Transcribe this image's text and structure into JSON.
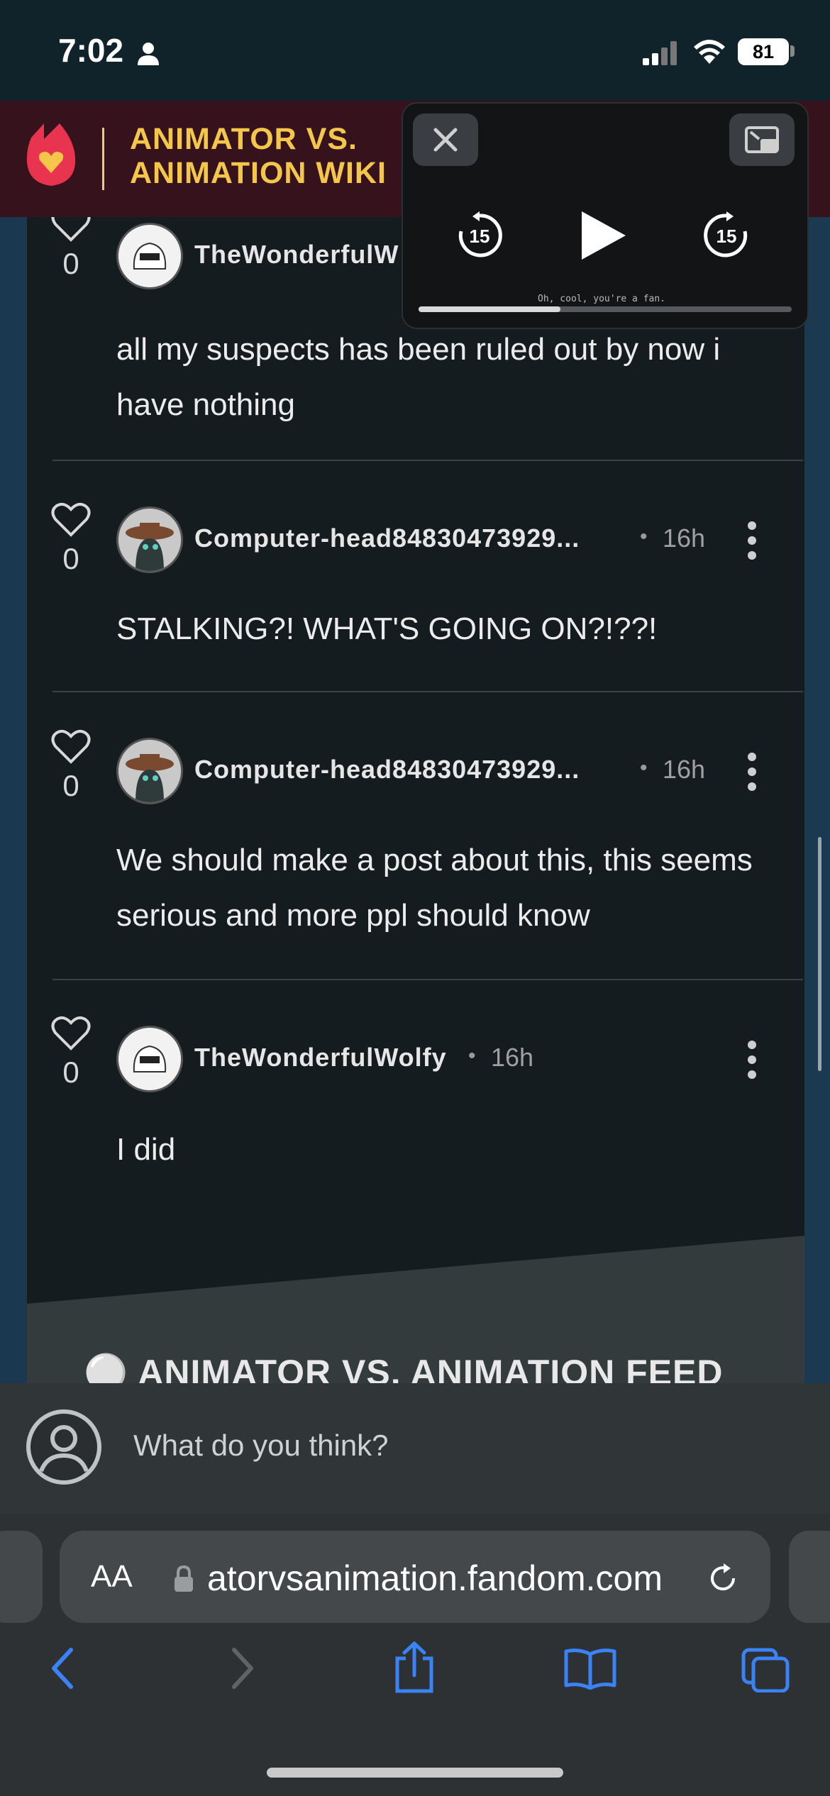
{
  "status_bar": {
    "time": "7:02",
    "battery": "81"
  },
  "wiki_header": {
    "title": "ANIMATOR VS. ANIMATION WIKI"
  },
  "pip_player": {
    "subtitle": "Oh, cool, you're a fan.",
    "skip_back_seconds": "15",
    "skip_forward_seconds": "15",
    "progress": 0.38
  },
  "comments": [
    {
      "user": "TheWonderfulW",
      "time": "",
      "likes": "0",
      "text": "all my suspects has been ruled out by now i have nothing"
    },
    {
      "user": "Computer-head84830473929...",
      "time": "16h",
      "likes": "0",
      "text": "STALKING?! WHAT'S GOING ON?!??!"
    },
    {
      "user": "Computer-head84830473929...",
      "time": "16h",
      "likes": "0",
      "text": "We should make a post about this, this seems serious and more ppl should know"
    },
    {
      "user": "TheWonderfulWolfy",
      "time": "16h",
      "likes": "0",
      "text": "I did"
    }
  ],
  "feed": {
    "title": "ANIMATOR VS. ANIMATION FEED"
  },
  "compose": {
    "placeholder": "What do you think?"
  },
  "browser": {
    "aa_label": "AA",
    "url": "atorvsanimation.fandom.com"
  },
  "colors": {
    "accent": "#f4c64a",
    "wiki_bar": "#36121d",
    "link_blue": "#3b82f6"
  }
}
